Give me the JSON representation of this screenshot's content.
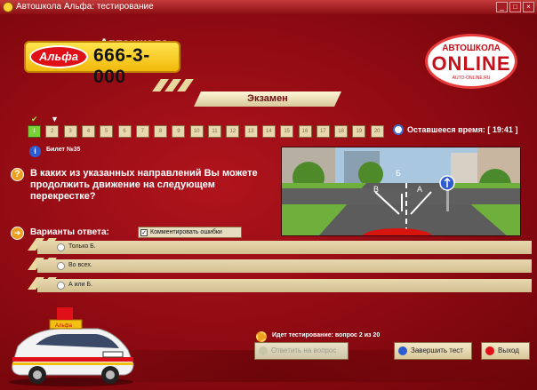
{
  "window": {
    "title": "Автошкола Альфа: тестирование",
    "controls": [
      "_",
      "□",
      "×"
    ]
  },
  "header": {
    "school_label": "Автошкола",
    "brand": "Альфа",
    "phone": "666-3-000",
    "online_top": "АВТОШКОЛА",
    "online_main": "ONLINE",
    "online_site": "AUTO-ONLINE.RU",
    "section": "Экзамен"
  },
  "questions_nav": {
    "numbers": [
      "1",
      "2",
      "3",
      "4",
      "5",
      "6",
      "7",
      "8",
      "9",
      "10",
      "11",
      "12",
      "13",
      "14",
      "15",
      "16",
      "17",
      "18",
      "19",
      "20"
    ],
    "active_index": 0,
    "timer_label": "Оставшееся время: [ 19:41 ]"
  },
  "ticket": "Билет №35",
  "question": {
    "text": "В каких из указанных направлений Вы можете продолжить движение на следующем перекрестке?",
    "image_labels": [
      "А",
      "Б",
      "В"
    ]
  },
  "answers": {
    "label": "Варианты ответа:",
    "comment_label": "Комментировать ошибки",
    "comment_checked": true,
    "items": [
      "Только Б.",
      "Во всех.",
      "А или Б."
    ]
  },
  "status": "Идет тестирование: вопрос 2 из 20",
  "car_sign": "Альфа",
  "buttons": {
    "answer": "Ответить на вопрос",
    "finish": "Завершить тест",
    "exit": "Выход"
  },
  "colors": {
    "background": "#9e0f17",
    "accent": "#f2c010",
    "panel": "#e8d8ae"
  }
}
